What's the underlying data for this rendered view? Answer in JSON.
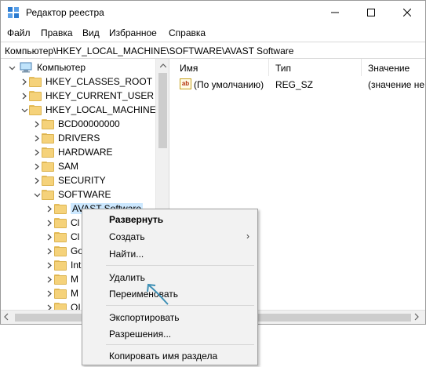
{
  "window": {
    "title": "Редактор реестра",
    "controls": {
      "minimize": "minimize-icon",
      "maximize": "maximize-icon",
      "close": "close-icon"
    }
  },
  "menubar": {
    "items": [
      "Файл",
      "Правка",
      "Вид",
      "Избранное",
      "Справка"
    ]
  },
  "address": {
    "path": "Компьютер\\HKEY_LOCAL_MACHINE\\SOFTWARE\\AVAST Software"
  },
  "tree": {
    "root": "Компьютер",
    "nodes": [
      "HKEY_CLASSES_ROOT",
      "HKEY_CURRENT_USER",
      "HKEY_LOCAL_MACHINE",
      "BCD00000000",
      "DRIVERS",
      "HARDWARE",
      "SAM",
      "SECURITY",
      "SOFTWARE",
      "AVAST Software",
      "Cl",
      "Cl",
      "Go",
      "Int",
      "M",
      "M",
      "OI"
    ]
  },
  "list": {
    "columns": [
      "Имя",
      "Тип",
      "Значение"
    ],
    "rows": [
      {
        "name": "(По умолчанию)",
        "type": "REG_SZ",
        "value": "(значение не"
      }
    ]
  },
  "context_menu": {
    "items": {
      "expand": "Развернуть",
      "create": "Создать",
      "find": "Найти...",
      "delete": "Удалить",
      "rename": "Переименовать",
      "export": "Экспортировать",
      "permissions": "Разрешения...",
      "copy_key_name": "Копировать имя раздела"
    }
  },
  "colors": {
    "selection": "#cce8ff",
    "folder": "#f5d27a",
    "accent_arrow": "#3d8fb5"
  }
}
